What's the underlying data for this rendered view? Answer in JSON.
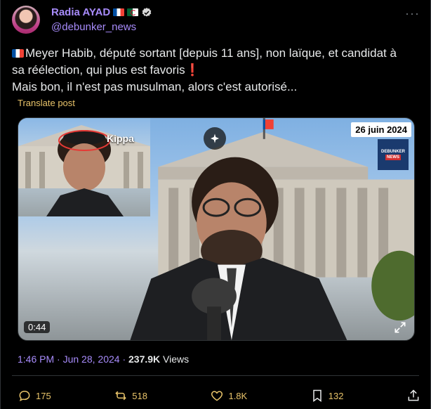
{
  "author": {
    "name": "Radia AYAD",
    "handle": "@debunker_news",
    "verified": true,
    "name_color": "#a78bfa"
  },
  "post": {
    "line1": "Meyer Habib, député sortant [depuis 11 ans], non laïque, et candidat à",
    "line2_before": "sa réélection, qui plus est favoris",
    "line2_emoji": "❗",
    "line3": "Mais bon, il n'est pas musulman, alors c'est autorisé...",
    "translate": "Translate post"
  },
  "media": {
    "overlay_label": "Kippa",
    "date_badge": "26 juin 2024",
    "logo_line1": "DEBUNKER",
    "logo_line2": "NEWS",
    "duration": "0:44"
  },
  "meta": {
    "time": "1:46 PM",
    "separator1": " · ",
    "date": "Jun 28, 2024",
    "separator2": " · ",
    "views_count": "237.9K",
    "views_label": " Views"
  },
  "actions": {
    "replies": "175",
    "reposts": "518",
    "likes": "1.8K",
    "bookmarks": "132"
  },
  "colors": {
    "background": "#000000",
    "accent": "#a78bfa",
    "action": "#e9c46a",
    "text": "#e7e9ea"
  },
  "icons": [
    "verified-icon",
    "more-icon",
    "grok-icon",
    "expand-icon",
    "reply-icon",
    "repost-icon",
    "like-icon",
    "bookmark-icon",
    "share-icon"
  ]
}
